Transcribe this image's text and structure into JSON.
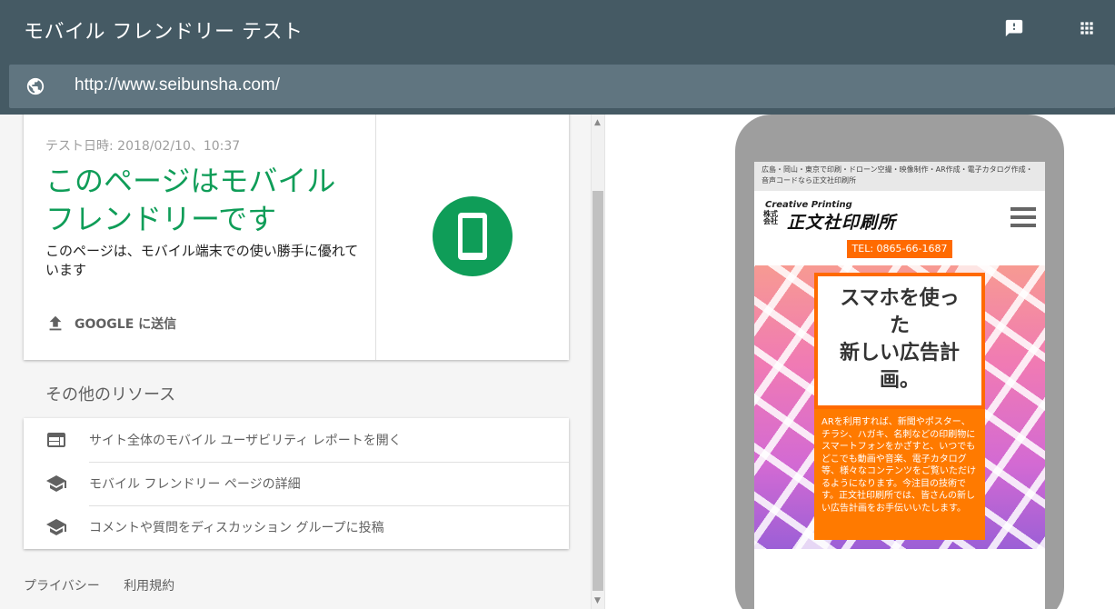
{
  "header": {
    "title": "モバイル フレンドリー テスト",
    "feedback_icon": "feedback-icon",
    "apps_icon": "apps-grid-icon"
  },
  "urlbar": {
    "icon": "globe-icon",
    "url": "http://www.seibunsha.com/"
  },
  "result": {
    "test_date": "テスト日時: 2018/02/10、10:37",
    "heading": "このページはモバイル フレンドリーです",
    "description": "このページは、モバイル端末での使い勝手に優れています",
    "submit_label": "GOOGLE に送信",
    "status_color": "#0f9d58"
  },
  "resources": {
    "title": "その他のリソース",
    "items": [
      {
        "icon": "web-layout-icon",
        "label": "サイト全体のモバイル ユーザビリティ レポートを開く"
      },
      {
        "icon": "school-icon",
        "label": "モバイル フレンドリー ページの詳細"
      },
      {
        "icon": "school-icon",
        "label": "コメントや質問をディスカッション グループに投稿"
      }
    ]
  },
  "footer": {
    "privacy": "プライバシー",
    "terms": "利用規約"
  },
  "preview": {
    "topline": "広島・岡山・東京で印刷・ドローン空撮・映像制作・AR作成・電子カタログ作成・音声コードなら正文社印刷所",
    "logo_sub": "Creative Printing",
    "logo_kabu": "株式会社",
    "logo_main": "正文社印刷所",
    "tel": "TEL: 0865-66-1687",
    "hero_title_lines": [
      "スマホを使っ",
      "た",
      "新しい広告計",
      "画。"
    ],
    "hero_desc": "ARを利用すれば、新聞やポスター、チラシ、ハガキ、名刺などの印刷物にスマートフォンをかざすと、いつでもどこでも動画や音楽、電子カタログ等、様々なコンテンツをご覧いただけるようになります。今注目の技術です。正文社印刷所では、皆さんの新しい広告計画をお手伝いいたします。",
    "accent": "#ff6a00"
  }
}
